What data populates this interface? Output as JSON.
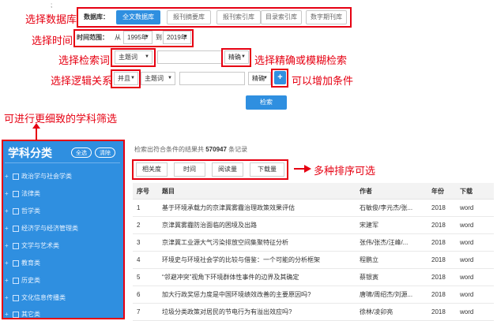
{
  "top_mark": ";",
  "annotations": {
    "db": "选择数据库",
    "time": "选择时间",
    "field": "选择检索词",
    "match": "选择精确或模糊检索",
    "logic": "选择逻辑关系",
    "add": "可以增加条件",
    "subject": "可进行更细致的学科筛选",
    "sort": "多种排序可选"
  },
  "database": {
    "label": "数据库：",
    "options": [
      "全文数据库",
      "报刊摘要库",
      "报刊索引库",
      "目录索引库",
      "数字期刊库"
    ],
    "active": "全文数据库"
  },
  "time_range": {
    "label": "时间范围：",
    "from_label": "从",
    "from": "1995年",
    "to_label": "到",
    "to": "2019年"
  },
  "condition1": {
    "field": "主题词",
    "value": "",
    "match": "精确"
  },
  "condition2": {
    "logic": "并且",
    "field": "主题词",
    "value": "",
    "match": "精确"
  },
  "add_button": "+",
  "search_button": "检索",
  "sidebar": {
    "title": "学科分类",
    "select_all": "全选",
    "clear": "清除",
    "items": [
      {
        "plus": "+",
        "label": "政治学与社会学类"
      },
      {
        "plus": "+",
        "label": "法律类"
      },
      {
        "plus": "+",
        "label": "哲学类"
      },
      {
        "plus": "+",
        "label": "经济学与经济管理类"
      },
      {
        "plus": "+",
        "label": "文学与艺术类"
      },
      {
        "plus": "+",
        "label": "教育类"
      },
      {
        "plus": "+",
        "label": "历史类"
      },
      {
        "plus": "+",
        "label": "文化信息传播类"
      },
      {
        "plus": "+",
        "label": "其它类"
      }
    ]
  },
  "result_summary": {
    "prefix": "检索出符合条件的结果共",
    "count": "570947",
    "suffix": "条记录"
  },
  "sort_options": [
    "相关度",
    "时间",
    "阅读量",
    "下载量"
  ],
  "table": {
    "headers": [
      "序号",
      "题目",
      "作者",
      "年份",
      "下载"
    ],
    "rows": [
      [
        "1",
        "基于环境承载力的京津冀雾霾治理政策效果评估",
        "石敏俊/李元杰/张...",
        "2018",
        "word"
      ],
      [
        "2",
        "京津冀雾霾防治面临的困境及出路",
        "宋建军",
        "2018",
        "word"
      ],
      [
        "3",
        "京津冀工业源大气污染排放空间集聚特征分析",
        "张伟/张杰/汪峰/...",
        "2018",
        "word"
      ],
      [
        "4",
        "环境史与环境社会学的比较与借鉴：一个可能的分析框架",
        "程鹏立",
        "2018",
        "word"
      ],
      [
        "5",
        "“邻避冲突”视角下环境群体性事件的边界及其确定",
        "蔡银寅",
        "2018",
        "word"
      ],
      [
        "6",
        "加大行政奖惩力度是中国环境绩效改善的主要原因吗?",
        "唐啸/周绍杰/刘源...",
        "2018",
        "word"
      ],
      [
        "7",
        "垃圾分类政策对居民的节电行为有溢出效应吗?",
        "徐林/凌卯亮",
        "2018",
        "word"
      ]
    ]
  }
}
